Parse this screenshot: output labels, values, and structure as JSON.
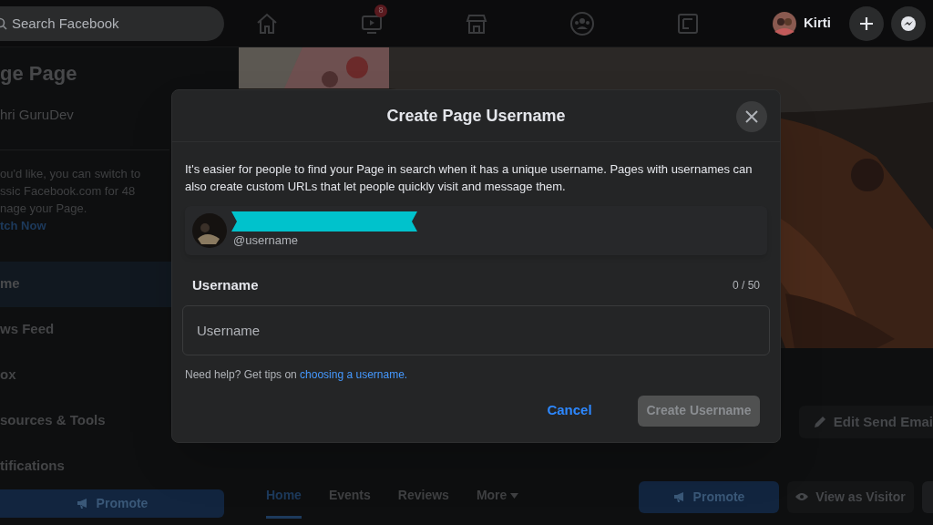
{
  "topbar": {
    "search": {
      "placeholder": "Search Facebook"
    },
    "nav": [
      {
        "kind": "home"
      },
      {
        "kind": "video",
        "badge": "8"
      },
      {
        "kind": "store"
      },
      {
        "kind": "groups"
      },
      {
        "kind": "gaming"
      }
    ],
    "profile": {
      "name": "Kirti"
    }
  },
  "sidebar": {
    "title": "ge Page",
    "page_name": "hri GuruDev",
    "notice": [
      "ou'd like, you can switch to",
      "ssic Facebook.com for 48",
      "nage your Page."
    ],
    "notice_link": "tch Now",
    "items": [
      {
        "label": "me",
        "selected": true
      },
      {
        "label": "ws Feed",
        "selected": false
      },
      {
        "label": "ox",
        "selected": false
      },
      {
        "label": "sources & Tools",
        "selected": false
      },
      {
        "label": "tifications",
        "selected": false
      }
    ],
    "promote": "Promote"
  },
  "page": {
    "edit_button": "Edit Send Emai",
    "tabs": [
      {
        "label": "Home",
        "selected": true
      },
      {
        "label": "Events",
        "selected": false
      },
      {
        "label": "Reviews",
        "selected": false
      },
      {
        "label": "More",
        "selected": false
      }
    ],
    "promote": "Promote",
    "view_as_visitor": "View as Visitor"
  },
  "dialog": {
    "title": "Create Page Username",
    "description": "It's easier for people to find your Page in search when it has a unique username. Pages with usernames can also create custom URLs that let people quickly visit and message them.",
    "handle": "@username",
    "field_label": "Username",
    "counter": "0 / 50",
    "input": {
      "placeholder": "Username"
    },
    "help": "Need help? Get tips on",
    "help_link": "choosing a username.",
    "cancel": "Cancel",
    "submit": {
      "label": "Create Username",
      "disabled": true
    }
  }
}
